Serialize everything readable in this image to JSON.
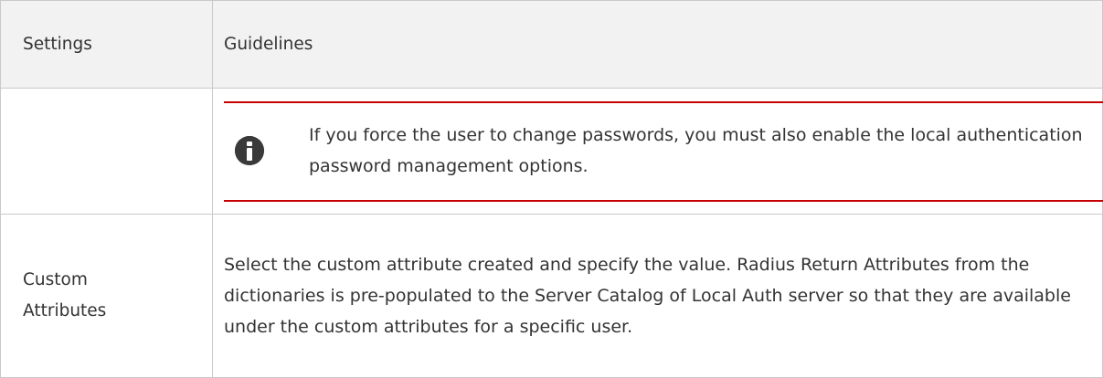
{
  "table": {
    "headers": {
      "settings": "Settings",
      "guidelines": "Guidelines"
    },
    "note": {
      "icon": "info-icon",
      "text": "If you force the user to change passwords, you must also enable the local authentication password management options.",
      "accent_color": "#c40000"
    },
    "rows": [
      {
        "setting": "Custom Attributes",
        "guideline": "Select the custom attribute created and specify the value. Radius Return Attributes from the dictionaries is pre-populated to the Server Catalog of Local Auth server so that they are available under the custom attributes for a specific user."
      }
    ]
  }
}
